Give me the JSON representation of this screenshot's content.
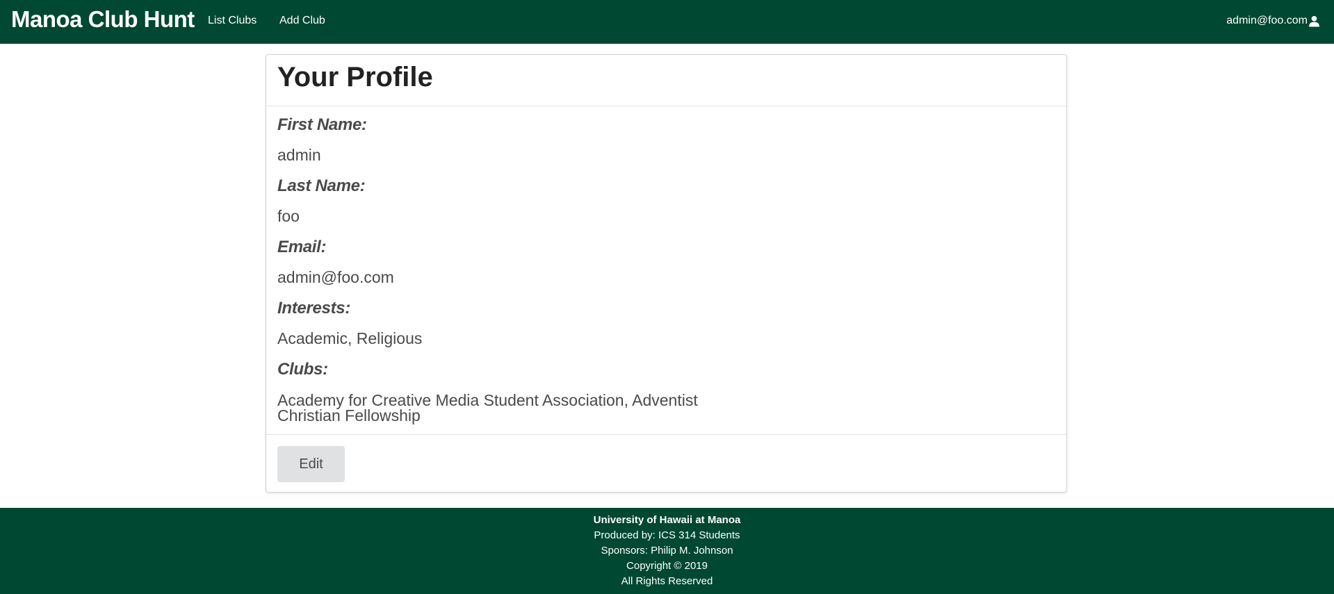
{
  "navbar": {
    "brand": "Manoa Club Hunt",
    "links": [
      "List Clubs",
      "Add Club"
    ],
    "user_email": "admin@foo.com",
    "user_icon": "user-icon"
  },
  "profile": {
    "title": "Your Profile",
    "fields": [
      {
        "label": "First Name:",
        "value": "admin"
      },
      {
        "label": "Last Name:",
        "value": "foo"
      },
      {
        "label": "Email:",
        "value": "admin@foo.com"
      },
      {
        "label": "Interests:",
        "value": "Academic, Religious"
      },
      {
        "label": "Clubs:",
        "value": "Academy for Creative Media Student Association, Adventist Christian Fellowship"
      }
    ],
    "edit_label": "Edit"
  },
  "footer": {
    "lines": [
      "University of Hawaii at Manoa",
      "Produced by: ICS 314 Students",
      "Sponsors: Philip M. Johnson",
      "Copyright © 2019",
      "All Rights Reserved"
    ]
  },
  "colors": {
    "brand_green": "#004831",
    "button_gray": "#e0e1e2",
    "text_dark": "#4a4a4a"
  }
}
